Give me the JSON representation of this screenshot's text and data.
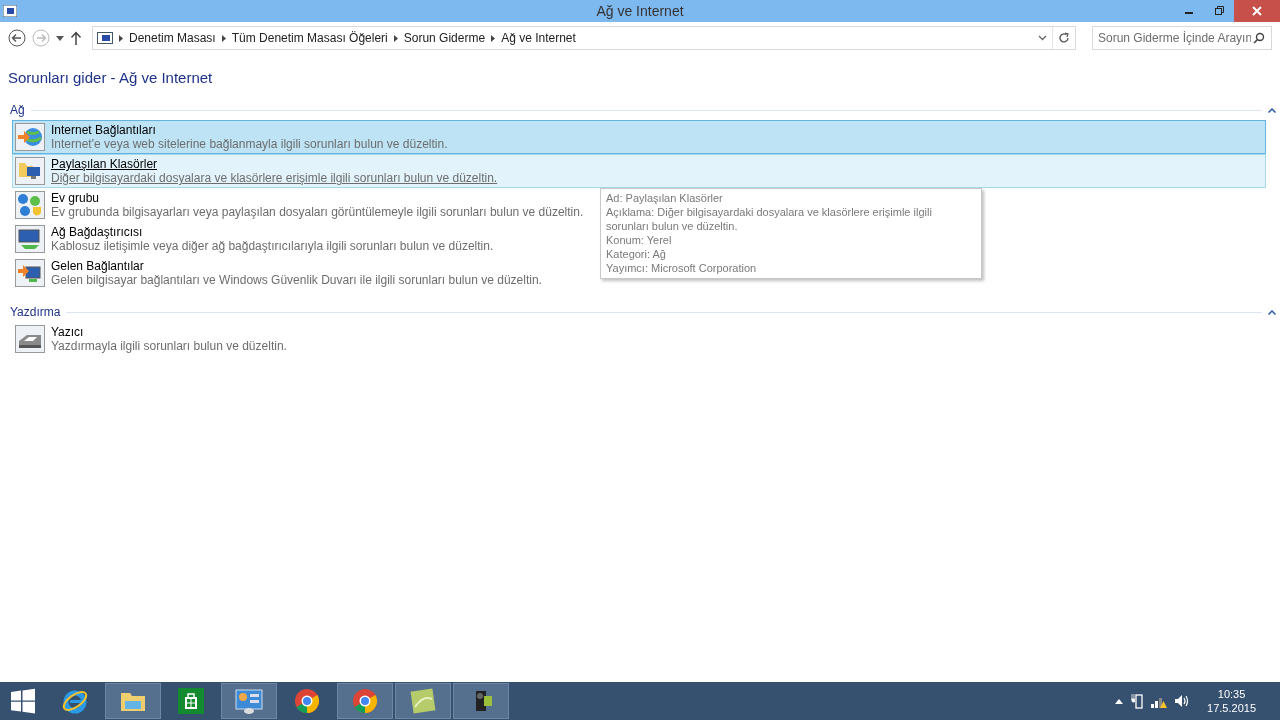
{
  "window": {
    "title": "Ağ ve Internet"
  },
  "address_bar": {
    "breadcrumbs": [
      "Denetim Masası",
      "Tüm Denetim Masası Öğeleri",
      "Sorun Giderme",
      "Ağ ve Internet"
    ]
  },
  "search": {
    "placeholder": "Sorun Giderme İçinde Arayın"
  },
  "heading": "Sorunları gider - Ağ ve Internet",
  "groups": [
    {
      "title": "Ağ",
      "expanded": true,
      "items": [
        {
          "kind": "globe",
          "name": "Internet Bağlantıları",
          "description": "Internet'e veya web sitelerine bağlanmayla ilgili sorunları bulun ve düzeltin.",
          "selected": true,
          "hovered": false
        },
        {
          "kind": "folder",
          "name": "Paylaşılan Klasörler",
          "description": "Diğer bilgisayardaki dosyalara ve klasörlere erişimle ilgili sorunları bulun ve düzeltin.",
          "selected": false,
          "hovered": true
        },
        {
          "kind": "homegroup",
          "name": "Ev grubu",
          "description": "Ev grubunda bilgisayarları veya paylaşılan dosyaları görüntülemeyle ilgili sorunları bulun ve düzeltin.",
          "selected": false,
          "hovered": false
        },
        {
          "kind": "adapter",
          "name": "Ağ Bağdaştırıcısı",
          "description": "Kablosuz iletişimle veya diğer ağ bağdaştırıcılarıyla ilgili sorunları bulun ve düzeltin.",
          "selected": false,
          "hovered": false
        },
        {
          "kind": "incoming",
          "name": "Gelen Bağlantılar",
          "description": "Gelen bilgisayar bağlantıları ve Windows Güvenlik Duvarı ile ilgili sorunları bulun ve düzeltin.",
          "selected": false,
          "hovered": false
        }
      ]
    },
    {
      "title": "Yazdırma",
      "expanded": true,
      "items": [
        {
          "kind": "printer",
          "name": "Yazıcı",
          "description": "Yazdırmayla ilgili sorunları bulun ve düzeltin.",
          "selected": false,
          "hovered": false
        }
      ]
    }
  ],
  "tooltip": {
    "lines": [
      "Ad: Paylaşılan Klasörler",
      "Açıklama: Diğer bilgisayardaki dosyalara ve klasörlere erişimle ilgili sorunları bulun ve düzeltin.",
      "Konum: Yerel",
      "Kategori: Ağ",
      "Yayımcı: Microsoft Corporation"
    ]
  },
  "taskbar": {
    "apps": [
      {
        "kind": "ie",
        "active": false
      },
      {
        "kind": "explorer",
        "active": true
      },
      {
        "kind": "store",
        "active": false
      },
      {
        "kind": "control",
        "active": true
      },
      {
        "kind": "chrome",
        "active": false
      },
      {
        "kind": "chrome",
        "active": true
      },
      {
        "kind": "notes",
        "active": true
      },
      {
        "kind": "camera",
        "active": true
      }
    ],
    "time": "10:35",
    "date": "17.5.2015"
  }
}
